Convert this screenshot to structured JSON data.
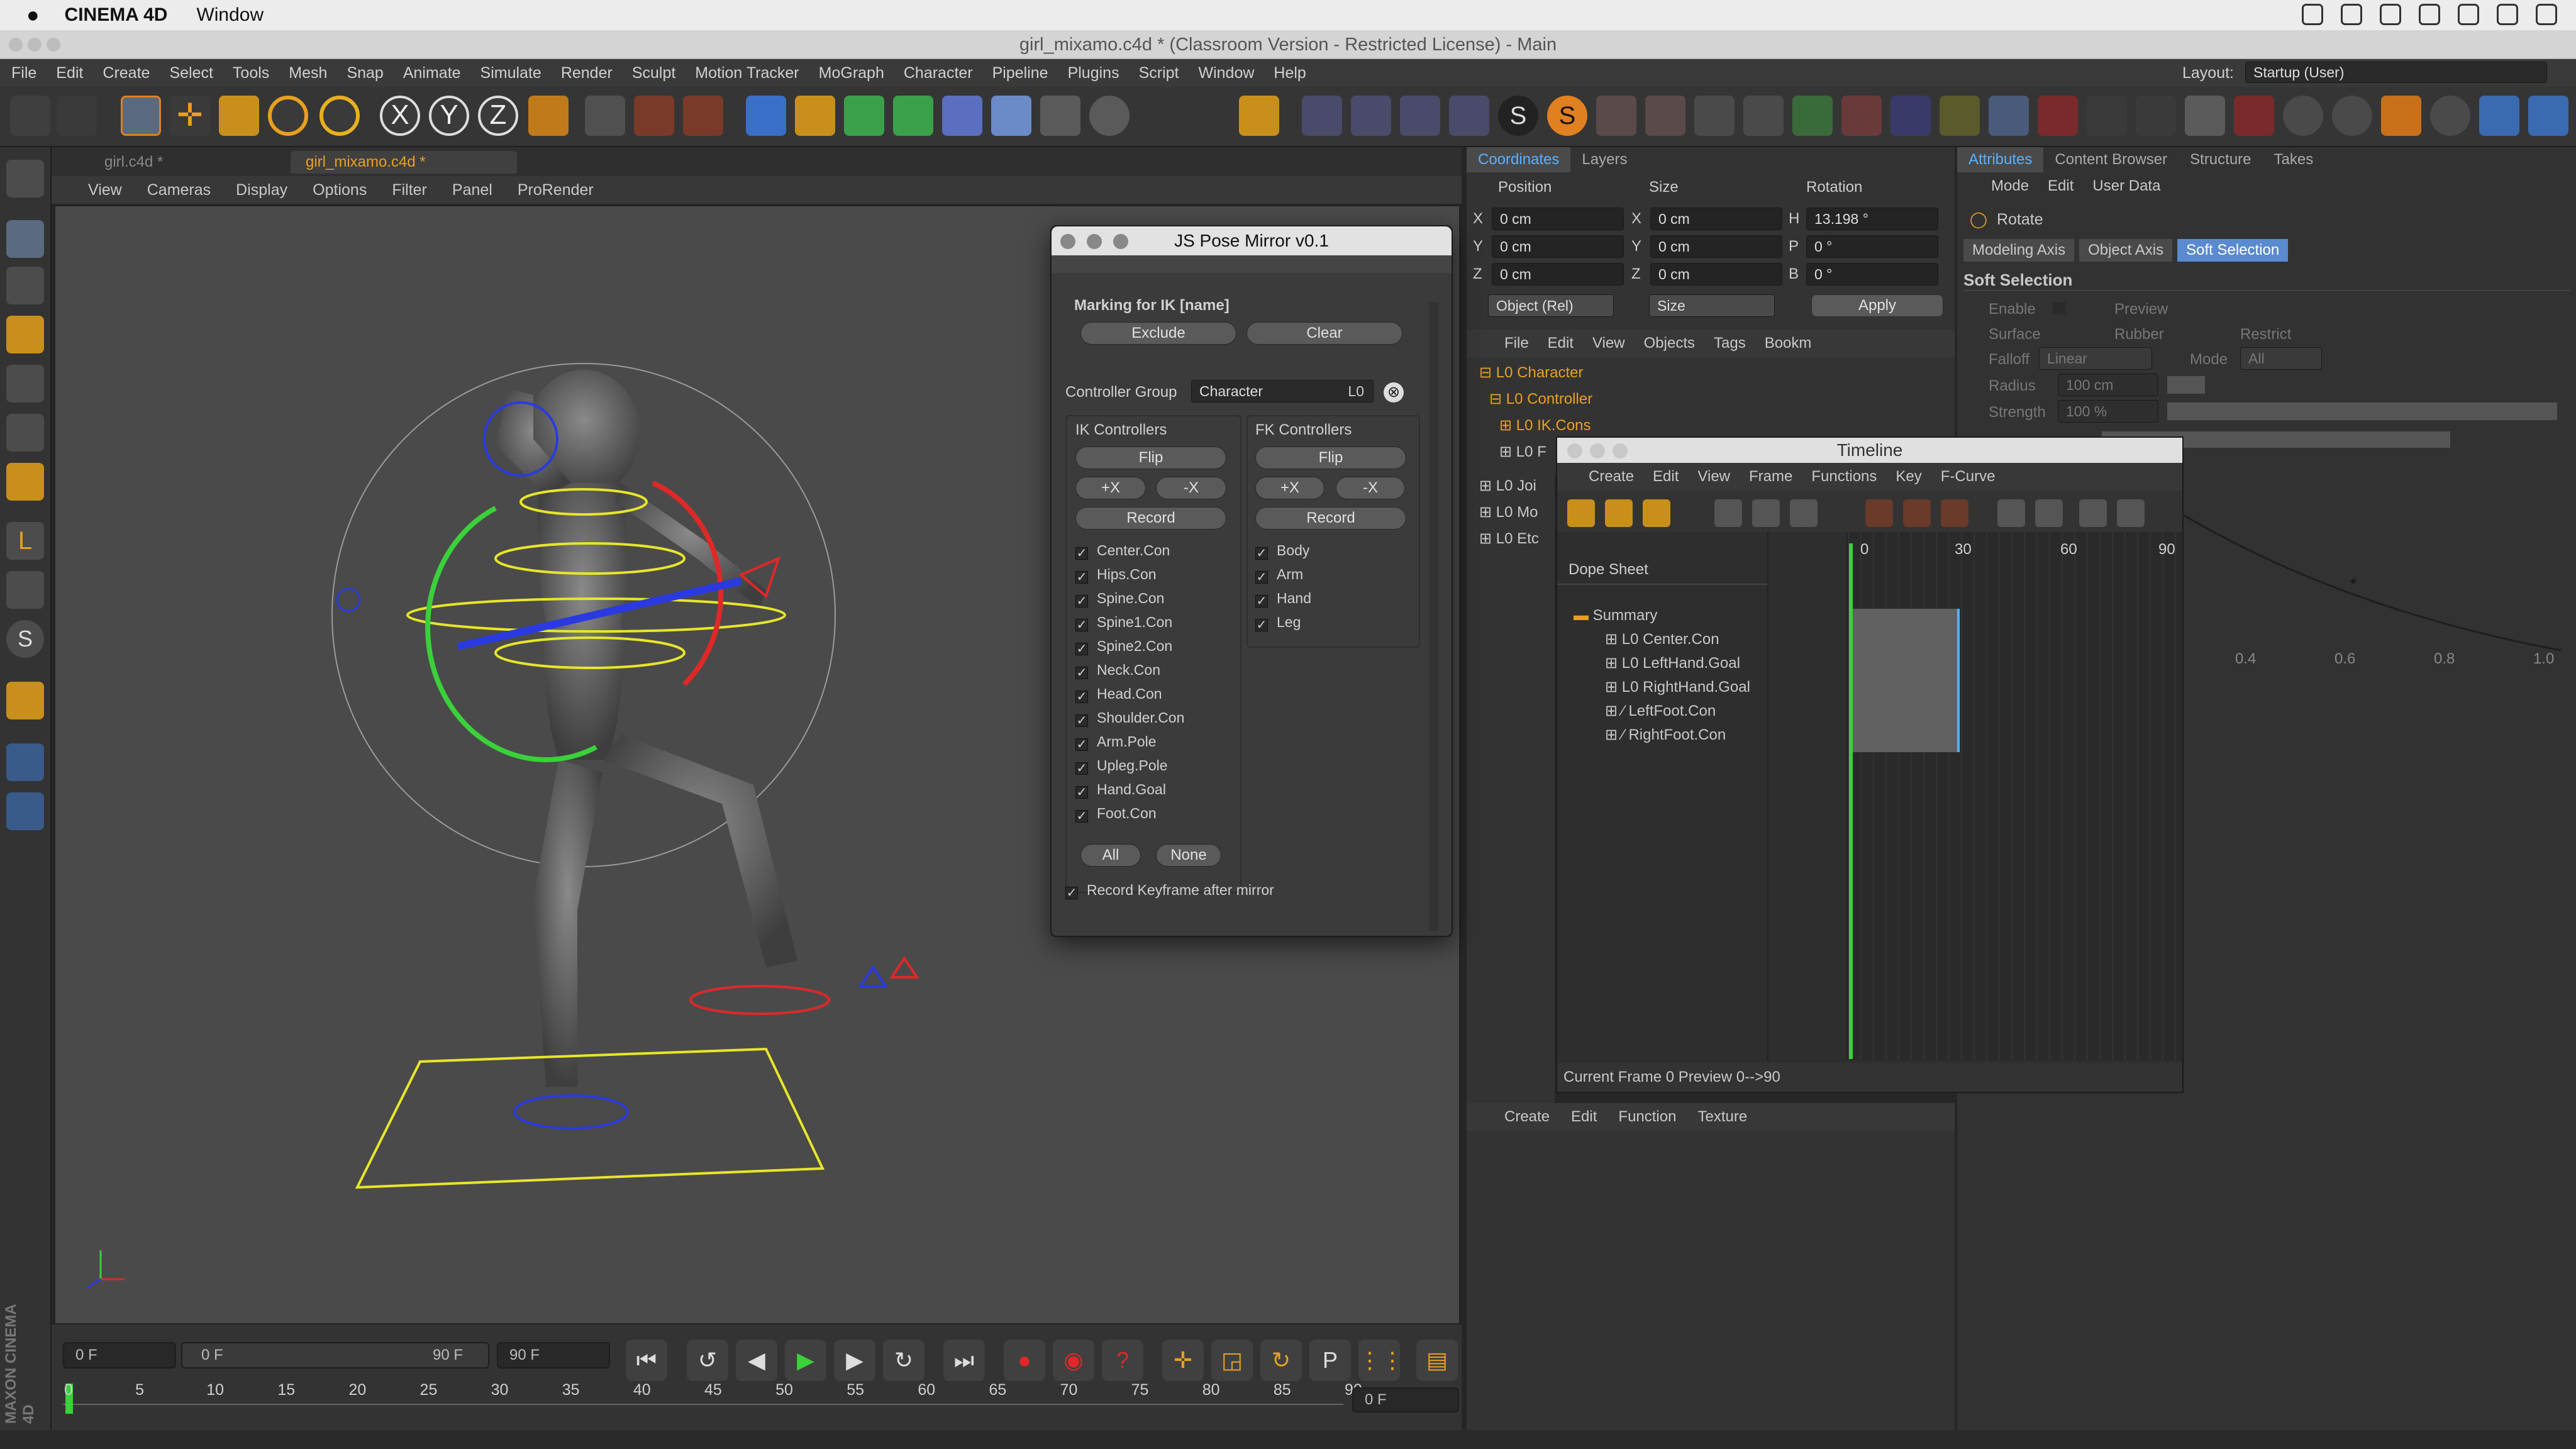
{
  "mac_menubar": {
    "app_name": "CINEMA 4D",
    "menu": "Window"
  },
  "window_title": "girl_mixamo.c4d * (Classroom Version - Restricted License) - Main",
  "menu": [
    "File",
    "Edit",
    "Create",
    "Select",
    "Tools",
    "Mesh",
    "Snap",
    "Animate",
    "Simulate",
    "Render",
    "Sculpt",
    "Motion Tracker",
    "MoGraph",
    "Character",
    "Pipeline",
    "Plugins",
    "Script",
    "Window",
    "Help"
  ],
  "layout": {
    "label": "Layout:",
    "value": "Startup (User)"
  },
  "doc_tabs": [
    "girl.c4d *",
    "girl_mixamo.c4d *"
  ],
  "viewport_menu": [
    "View",
    "Cameras",
    "Display",
    "Options",
    "Filter",
    "Panel",
    "ProRender"
  ],
  "branding": "MAXON CINEMA 4D",
  "timeline_bar": {
    "start_field": "0 F",
    "range_start": "0 F",
    "range_end": "90 F",
    "end_field": "90 F",
    "current_field": "0 F",
    "ticks": [
      "0",
      "5",
      "10",
      "15",
      "20",
      "25",
      "30",
      "35",
      "40",
      "45",
      "50",
      "55",
      "60",
      "65",
      "70",
      "75",
      "80",
      "85",
      "90"
    ]
  },
  "pose_mirror": {
    "title": "JS Pose Mirror v0.1",
    "marking_label": "Marking for IK [name]",
    "exclude_button": "Exclude",
    "clear_button": "Clear",
    "controller_group_label": "Controller Group",
    "controller_group_value": "Character",
    "ik": {
      "title": "IK Controllers",
      "flip": "Flip",
      "plus_x": "+X",
      "minus_x": "-X",
      "record": "Record",
      "items": [
        "Center.Con",
        "Hips.Con",
        "Spine.Con",
        "Spine1.Con",
        "Spine2.Con",
        "Neck.Con",
        "Head.Con",
        "Shoulder.Con",
        "Arm.Pole",
        "Upleg.Pole",
        "Hand.Goal",
        "Foot.Con"
      ],
      "all_button": "All",
      "none_button": "None"
    },
    "fk": {
      "title": "FK Controllers",
      "flip": "Flip",
      "plus_x": "+X",
      "minus_x": "-X",
      "record": "Record",
      "items": [
        "Body",
        "Arm",
        "Hand",
        "Leg"
      ]
    },
    "record_after": "Record Keyframe after mirror"
  },
  "coordinates": {
    "tabs": [
      "Coordinates",
      "Layers"
    ],
    "headers": [
      "Position",
      "Size",
      "Rotation"
    ],
    "rows": [
      {
        "pos_axis": "X",
        "pos": "0 cm",
        "size_axis": "X",
        "size": "0 cm",
        "rot_axis": "H",
        "rot": "13.198 °"
      },
      {
        "pos_axis": "Y",
        "pos": "0 cm",
        "size_axis": "Y",
        "size": "0 cm",
        "rot_axis": "P",
        "rot": "0 °"
      },
      {
        "pos_axis": "Z",
        "pos": "0 cm",
        "size_axis": "Z",
        "size": "0 cm",
        "rot_axis": "B",
        "rot": "0 °"
      }
    ],
    "mode_select": "Object (Rel)",
    "size_select": "Size",
    "apply_button": "Apply"
  },
  "objects": {
    "menu": [
      "File",
      "Edit",
      "View",
      "Objects",
      "Tags",
      "Bookm"
    ],
    "tree": [
      {
        "name": "Character",
        "indent": 0,
        "color": "#e8a020"
      },
      {
        "name": "Controller",
        "indent": 1,
        "color": "#e8a020"
      },
      {
        "name": "IK.Cons",
        "indent": 2,
        "color": "#e8a020"
      },
      {
        "name": "F",
        "indent": 2,
        "color": "#c8c8c8"
      },
      {
        "name": "Joi",
        "indent": 0,
        "color": "#c8c8c8"
      },
      {
        "name": "Mo",
        "indent": 0,
        "color": "#c8c8c8"
      },
      {
        "name": "Etc",
        "indent": 0,
        "color": "#c8c8c8"
      }
    ]
  },
  "material_menu": [
    "Create",
    "Edit",
    "Function",
    "Texture"
  ],
  "attributes": {
    "tabs": [
      "Attributes",
      "Content Browser",
      "Structure",
      "Takes"
    ],
    "menu": [
      "Mode",
      "Edit",
      "User Data"
    ],
    "tool_name": "Rotate",
    "subtabs": [
      "Modeling Axis",
      "Object Axis",
      "Soft Selection"
    ],
    "section": "Soft Selection",
    "enable": "Enable",
    "preview": "Preview",
    "surface": "Surface",
    "rubber": "Rubber",
    "restrict": "Restrict",
    "falloff_label": "Falloff",
    "falloff_value": "Linear",
    "mode_label": "Mode",
    "mode_value": "All",
    "radius_label": "Radius",
    "radius_value": "100 cm",
    "strength_label": "Strength",
    "strength_value": "100 %",
    "graph_ticks": [
      "0.4",
      "0.6",
      "0.8",
      "1.0"
    ]
  },
  "timeline": {
    "title": "Timeline",
    "menu": [
      "Create",
      "Edit",
      "View",
      "Frame",
      "Functions",
      "Key",
      "F-Curve"
    ],
    "dope_sheet": "Dope Sheet",
    "ruler": [
      "0",
      "30",
      "60",
      "90"
    ],
    "tracks": [
      "Summary",
      "Center.Con",
      "LeftHand.Goal",
      "RightHand.Goal",
      "LeftFoot.Con",
      "RightFoot.Con"
    ],
    "status": "Current Frame  0  Preview  0-->90"
  },
  "colors": {
    "accent": "#5ab0ff",
    "orange": "#e8a020",
    "ik_green": "#3ad13a",
    "ik_red": "#e02828",
    "ik_blue": "#2a3ae0",
    "yellow": "#e6e62a"
  }
}
